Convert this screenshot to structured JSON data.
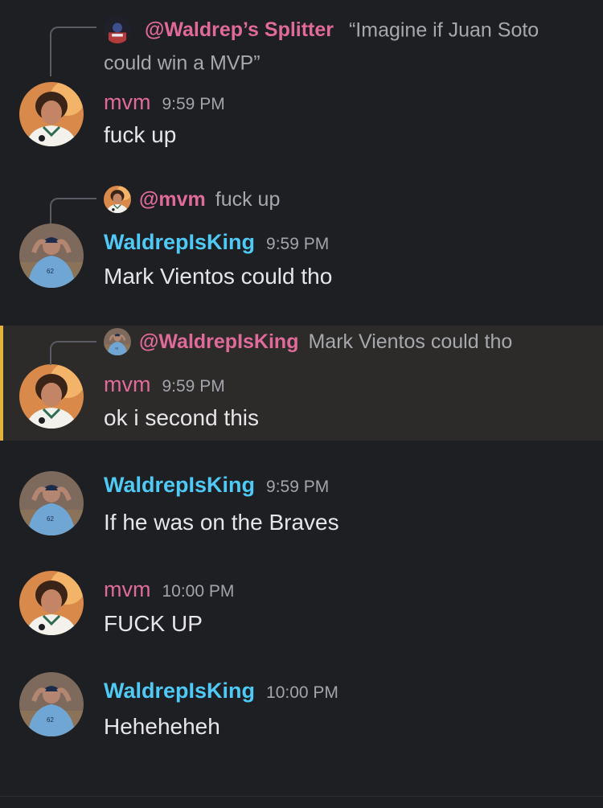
{
  "messages": [
    {
      "reply": {
        "name": "@Waldrep’s Splitter",
        "text": "“Imagine if Juan Soto could win a MVP”",
        "avatar": "splitter-avatar"
      },
      "username": "mvm",
      "time": "9:59 PM",
      "text": "fuck up",
      "avatar": "mvm-avatar"
    },
    {
      "reply": {
        "name": "@mvm",
        "text": "fuck up",
        "avatar": "mvm-avatar"
      },
      "username": "WaldrepIsKing",
      "time": "9:59 PM",
      "text": "Mark Vientos could tho",
      "avatar": "waldrep-avatar"
    },
    {
      "reply": {
        "name": "@WaldrepIsKing",
        "text": "Mark Vientos could tho",
        "avatar": "waldrep-avatar"
      },
      "username": "mvm",
      "time": "9:59 PM",
      "text": "ok i second this",
      "avatar": "mvm-avatar",
      "highlighted": true
    },
    {
      "username": "WaldrepIsKing",
      "time": "9:59 PM",
      "text": "If he was on the Braves",
      "avatar": "waldrep-avatar"
    },
    {
      "username": "mvm",
      "time": "10:00 PM",
      "text": "FUCK UP",
      "avatar": "mvm-avatar"
    },
    {
      "username": "WaldrepIsKing",
      "time": "10:00 PM",
      "text": "Heheheheh",
      "avatar": "waldrep-avatar"
    }
  ],
  "colors": {
    "background": "#1e1f23",
    "mvm_name": "#e06a9a",
    "waldrep_name": "#4fc9f5",
    "highlight_bg": "#2c2b29",
    "highlight_bar": "#e3b23c"
  }
}
